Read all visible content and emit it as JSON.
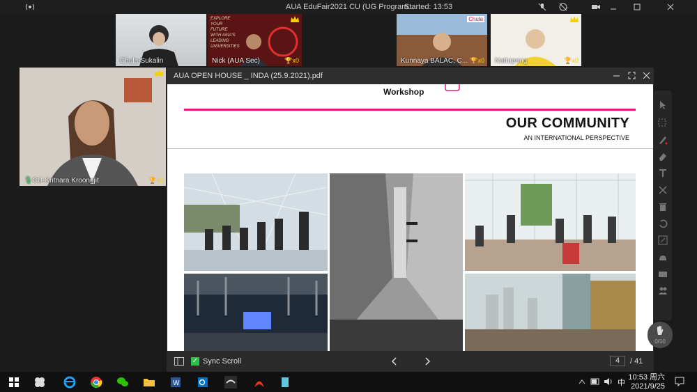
{
  "meeting": {
    "title": "AUA EduFair2021 CU (UG Program...",
    "started": "Started: 13:53"
  },
  "participants": [
    {
      "name": "Chula-Sukalin",
      "score": ""
    },
    {
      "name": "Nick (AUA Sec)",
      "score": "x0",
      "overlay_text": "EXPLORE YOUR FUTURE WITH ASIA'S LEADING UNIVERSITIES"
    },
    {
      "name": "Kunnaya BALAC, C...",
      "score": "x0",
      "badge": "Chula"
    },
    {
      "name": "Nattapong",
      "score": "x0"
    },
    {
      "name": "CU-Kritnara Kroongjit",
      "score": "x0"
    }
  ],
  "pdf": {
    "filename": "AUA OPEN HOUSE _ INDA (25.9.2021).pdf",
    "workshop": "Workshop",
    "heading": "OUR COMMUNITY",
    "subheading": "AN INTERNATIONAL PERSPECTIVE",
    "sync_scroll": "Sync Scroll",
    "current_page": "4",
    "total_pages": "/ 41"
  },
  "tools_progress": "0/10",
  "clock": {
    "time": "10:53 周六",
    "date": "2021/9/25"
  },
  "ime": "中",
  "colors": {
    "accent_pink": "#e8197c",
    "trophy": "#f5d000",
    "checkbox_green": "#2fbf4a"
  }
}
